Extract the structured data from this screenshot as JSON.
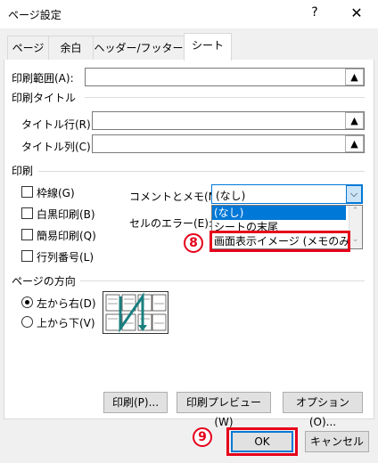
{
  "window": {
    "title": "ページ設定",
    "help": "?",
    "close": "✕"
  },
  "tabs": [
    {
      "label": "ページ"
    },
    {
      "label": "余白"
    },
    {
      "label": "ヘッダー/フッター"
    },
    {
      "label": "シート"
    }
  ],
  "print_area": {
    "label": "印刷範囲(A):",
    "value": ""
  },
  "print_titles": {
    "group_label": "印刷タイトル",
    "rows_label": "タイトル行(R):",
    "cols_label": "タイトル列(C):"
  },
  "print_group": {
    "label": "印刷",
    "gridlines": "枠線(G)",
    "black_white": "白黒印刷(B)",
    "draft": "簡易印刷(Q)",
    "row_col_headings": "行列番号(L)",
    "comments_label": "コメントとメモ(M):",
    "comments_value": "(なし)",
    "errors_label": "セルのエラー(E):",
    "dropdown_options": [
      "(なし)",
      "シートの末尾",
      "画面表示イメージ (メモのみ)"
    ]
  },
  "page_order": {
    "label": "ページの方向",
    "down_then_over": "左から右(D)",
    "over_then_down": "上から下(V)",
    "selected": "左から右(D)"
  },
  "buttons": {
    "print": "印刷(P)...",
    "preview": "印刷プレビュー(W)",
    "options": "オプション(O)...",
    "ok": "OK",
    "cancel": "キャンセル"
  },
  "annotations": {
    "step8": "8",
    "step9": "9",
    "color": "#e6001a"
  },
  "icons": {
    "ref_button": "collapse-dialog-icon",
    "arrow": "chevron-down-icon"
  }
}
